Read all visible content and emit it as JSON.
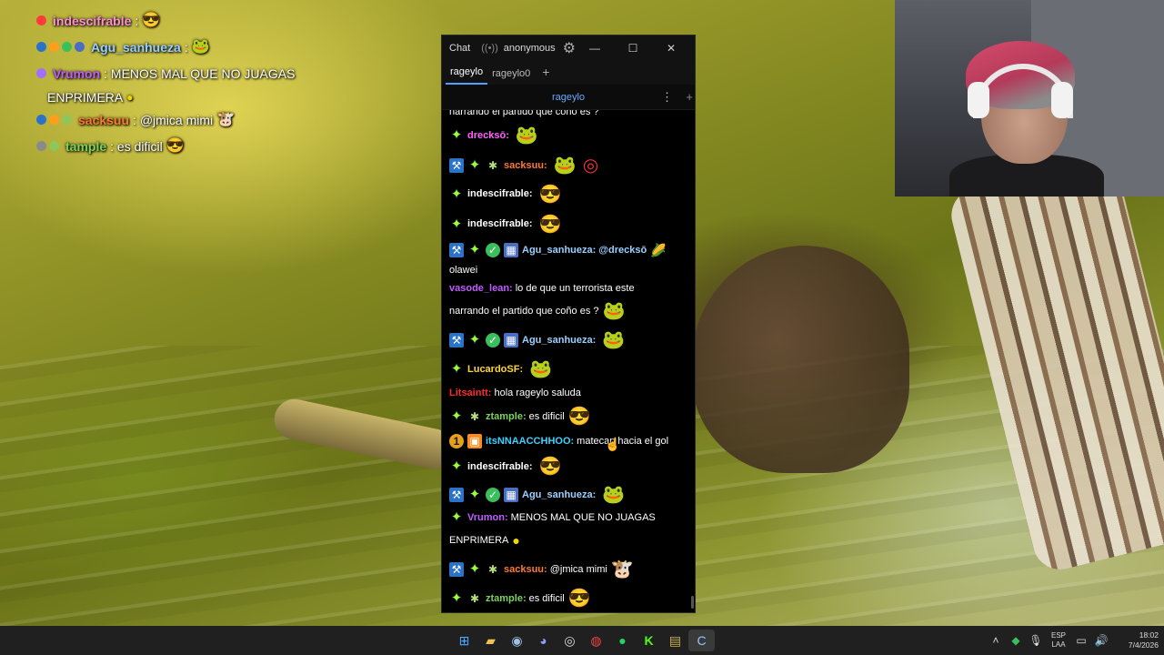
{
  "overlay_chat": [
    {
      "badges": [
        "red-dot-badge"
      ],
      "user": "indescifrable",
      "user_color": "#ff3b3b",
      "text": ":",
      "emote": "yellow-glasses-emote"
    },
    {
      "badges": [
        "hammer-badge",
        "orange-badge",
        "check-badge",
        "grid-badge"
      ],
      "user": "Agu_sanhueza",
      "user_color": "#9ad0ff",
      "text": ":",
      "emote": "green-frog-emote"
    },
    {
      "badges": [
        "purple-ring-badge"
      ],
      "user": "Vrumon",
      "user_color": "#c15bff",
      "text": ": MENOS MAL QUE NO JUAGAS",
      "continuation": "ENPRIMERA",
      "emote": "small-yellow-emote"
    },
    {
      "badges": [
        "hammer-badge",
        "orange-badge",
        "bug-badge"
      ],
      "user": "sacksuu",
      "user_color": "#ff7a2f",
      "text": ": @jmica mimi",
      "emote": "cow-emote"
    },
    {
      "badges": [
        "gray-badge",
        "bug-badge"
      ],
      "user": "tample",
      "user_color": "#7bd35a",
      "text": ": es dificil",
      "emote": "yellow-glasses-emote"
    }
  ],
  "window": {
    "title": "Chat",
    "live_icon": "broadcast-icon",
    "user": "anonymous",
    "settings_icon": "gear-icon",
    "minimize": "—",
    "maximize": "☐",
    "close": "✕"
  },
  "tabs": [
    {
      "label": "rageylo",
      "active": true
    },
    {
      "label": "rageylo0",
      "active": false
    }
  ],
  "tab_add": "+",
  "channel": {
    "name": "rageylo",
    "menu": "⋮",
    "add": "+"
  },
  "messages": [
    {
      "badges": [],
      "user": "",
      "user_color": "#ffffff",
      "text": "narrando el partido que coño es ?",
      "emote": "pepe-emote",
      "cut": true
    },
    {
      "badges": [
        "star"
      ],
      "user": "drecksō:",
      "user_color": "#ff63ff",
      "text": "",
      "emote": "pepe-emote"
    },
    {
      "badges": [
        "hammer",
        "star",
        "bug"
      ],
      "user": "sacksuu:",
      "user_color": "#ff7a2f",
      "text": "",
      "emote": "pepe-target-emote"
    },
    {
      "badges": [
        "star"
      ],
      "user": "indescifrable:",
      "user_color": "#ffffff",
      "text": "",
      "emote": "yellow-glasses-emote"
    },
    {
      "badges": [
        "star"
      ],
      "user": "indescifrable:",
      "user_color": "#ffffff",
      "text": "",
      "emote": "yellow-glasses-emote"
    },
    {
      "badges": [
        "hammer",
        "star",
        "check",
        "grid"
      ],
      "user": "Agu_sanhueza:",
      "user_color": "#9ad0ff",
      "text": "@drecksō",
      "emote": "corn-emote",
      "continuation": "olawei"
    },
    {
      "badges": [],
      "user": "vasode_lean:",
      "user_color": "#c15bff",
      "text": "lo de que un terrorista este",
      "continuation": "narrando el partido que coño es ?",
      "emote": "pepe-emote"
    },
    {
      "badges": [
        "hammer",
        "star",
        "check",
        "grid"
      ],
      "user": "Agu_sanhueza:",
      "user_color": "#9ad0ff",
      "text": "",
      "emote": "pepe-emote"
    },
    {
      "badges": [
        "star"
      ],
      "user": "LucardoSF:",
      "user_color": "#ffd82a",
      "text": "",
      "emote": "green-frog-emote"
    },
    {
      "badges": [],
      "user": "Litsaintt:",
      "user_color": "#ff2a2a",
      "text": "hola rageylo saluda",
      "emote": ""
    },
    {
      "badges": [
        "star",
        "bug"
      ],
      "user": "ztample:",
      "user_color": "#7bd35a",
      "text": "es dificil",
      "emote": "yellow-glasses-emote"
    },
    {
      "badges": [
        "one",
        "box"
      ],
      "user": "itsNNAACCHHOO:",
      "user_color": "#3dd0ff",
      "text": "matecap hacia el gol",
      "emote": ""
    },
    {
      "badges": [
        "star"
      ],
      "user": "indescifrable:",
      "user_color": "#ffffff",
      "text": "",
      "emote": "yellow-glasses-emote"
    },
    {
      "badges": [
        "hammer",
        "star",
        "check",
        "grid"
      ],
      "user": "Agu_sanhueza:",
      "user_color": "#9ad0ff",
      "text": "",
      "emote": "green-frog-emote"
    },
    {
      "badges": [
        "star"
      ],
      "user": "Vrumon:",
      "user_color": "#c15bff",
      "text": "MENOS MAL QUE NO JUAGAS",
      "continuation": "ENPRIMERA",
      "emote": "small-yellow-emote"
    },
    {
      "badges": [
        "hammer",
        "star",
        "bug"
      ],
      "user": "sacksuu:",
      "user_color": "#ff7a2f",
      "text": "@jmica mimi",
      "emote": "cow-emote"
    },
    {
      "badges": [
        "star",
        "bug"
      ],
      "user": "ztample:",
      "user_color": "#7bd35a",
      "text": "es dificil",
      "emote": "yellow-glasses-emote"
    }
  ],
  "taskbar": {
    "apps": [
      "windows-start-icon",
      "file-explorer-icon",
      "steam-icon",
      "discord-icon",
      "obs-icon",
      "chrome-icon",
      "spotify-icon",
      "kick-icon",
      "game-icon",
      "chatterino-icon"
    ],
    "lang_top": "ESP",
    "lang_bottom": "LAA",
    "time": "18:02",
    "date": "7/4/2026"
  }
}
